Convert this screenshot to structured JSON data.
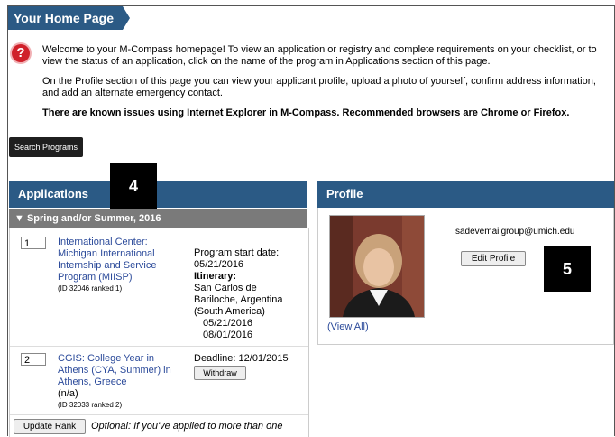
{
  "header": {
    "title": "Your Home Page"
  },
  "welcome": {
    "p1": "Welcome to your M-Compass homepage! To view an application or registry and complete requirements on your checklist, or to view the status of an application, click on the name of the program in Applications section of this page.",
    "p2": "On the Profile section of this page you can view your applicant profile, upload a photo of yourself, confirm address information, and add an alternate emergency contact.",
    "p3": "There are known issues using Internet Explorer in M-Compass. Recommended browsers are Chrome or Firefox."
  },
  "search_button": "Search Programs",
  "badges": {
    "apps": "4",
    "profile": "5"
  },
  "applications": {
    "title": "Applications",
    "season": "Spring and/or Summer, 2016",
    "items": [
      {
        "rank": "1",
        "name_lines": [
          "International Center:",
          "Michigan International",
          "Internship and Service",
          "Program (MIISP)"
        ],
        "meta": "(ID 32046 ranked 1)",
        "start_label": "Program start date:",
        "start_date": "05/21/2016",
        "itinerary_label": "Itinerary:",
        "itinerary_lines": [
          "San Carlos de",
          "Bariloche, Argentina",
          "(South America)"
        ],
        "itinerary_dates": [
          "05/21/2016",
          "08/01/2016"
        ]
      },
      {
        "rank": "2",
        "name_lines": [
          "CGIS: College Year in",
          "Athens (CYA, Summer) in",
          "Athens, Greece"
        ],
        "status": "(n/a)",
        "meta": "(ID 32033 ranked 2)",
        "deadline": "Deadline: 12/01/2015",
        "withdraw": "Withdraw"
      }
    ],
    "update_rank": "Update Rank",
    "optional_text": "Optional: If you've applied to more than one"
  },
  "profile": {
    "title": "Profile",
    "email": "sadevemailgroup@umich.edu",
    "edit_button": "Edit Profile",
    "view_all": "(View All)"
  }
}
